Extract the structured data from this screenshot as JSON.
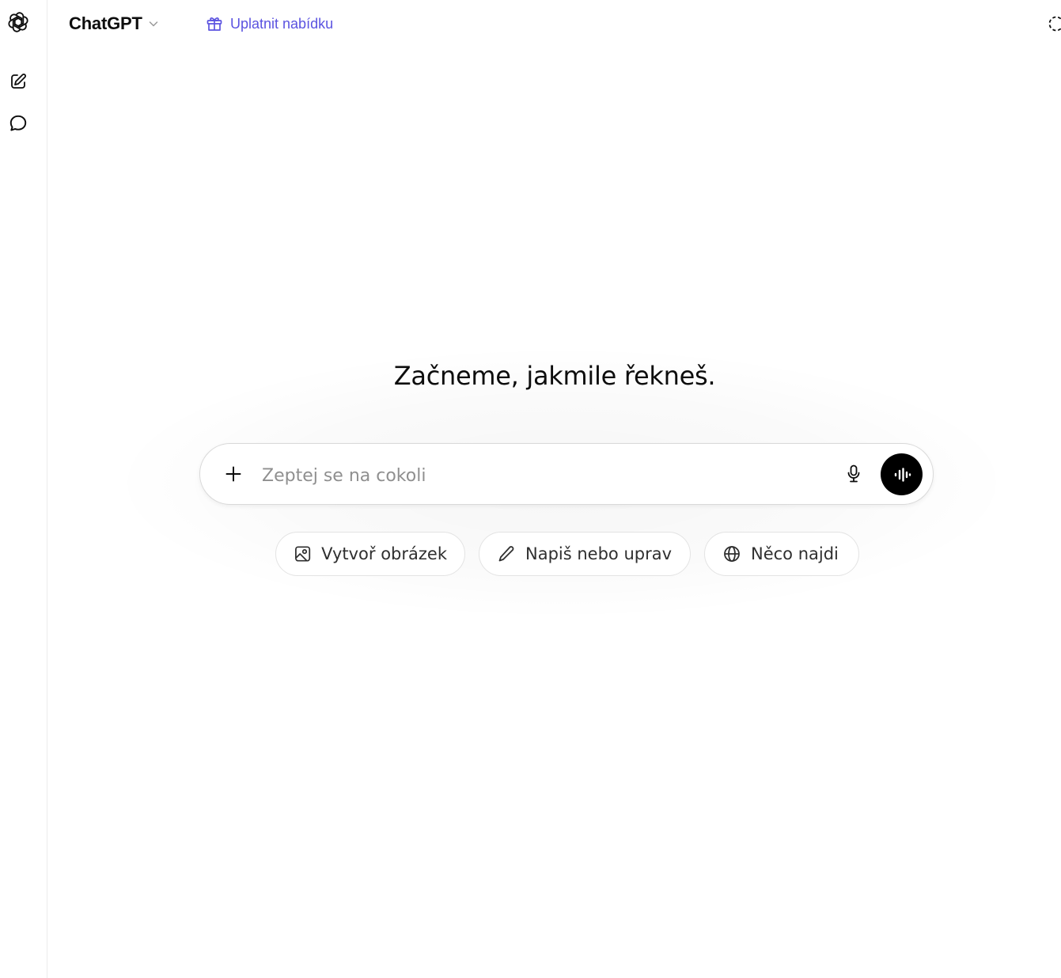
{
  "header": {
    "model_name": "ChatGPT",
    "offer_label": "Uplatnit nabídku",
    "offer_color": "#5b53e0"
  },
  "sidebar": {
    "items": [
      {
        "icon": "openai-logo-icon"
      },
      {
        "icon": "new-chat-icon"
      },
      {
        "icon": "chat-bubble-icon"
      }
    ]
  },
  "main": {
    "headline": "Začneme, jakmile řekneš.",
    "composer": {
      "placeholder": "Zeptej se na cokoli",
      "value": ""
    },
    "suggestions": [
      {
        "label": "Vytvoř obrázek",
        "icon": "image-icon"
      },
      {
        "label": "Napiš nebo uprav",
        "icon": "pencil-icon"
      },
      {
        "label": "Něco najdi",
        "icon": "globe-icon"
      }
    ]
  },
  "colors": {
    "voice_button": "#000000",
    "text": "#0d0d0d",
    "placeholder": "#8f8f8f"
  }
}
